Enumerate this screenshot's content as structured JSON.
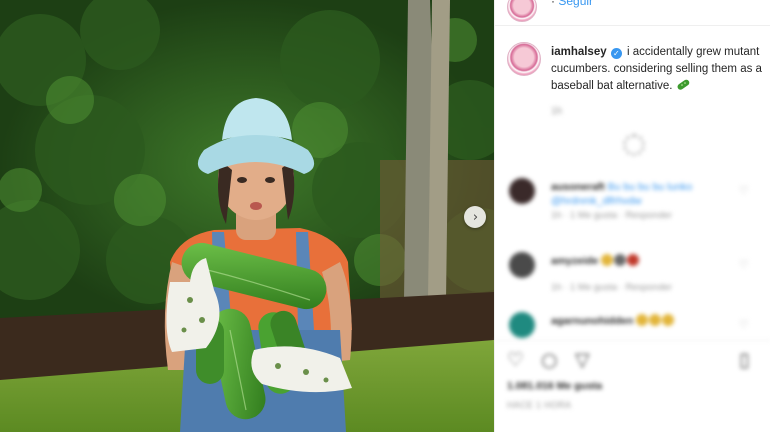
{
  "header_partial": {
    "text": "· ",
    "link": "Seguir"
  },
  "caption": {
    "username": "iamhalsey",
    "text": "i accidentally grew mutant cucumbers. considering selling them as a baseball bat alternative."
  },
  "caption_time": "1h",
  "comments": [
    {
      "username": "ausoneraft",
      "text": "Bu bu bu bu lunko",
      "mention": "@hrdnmk_dlfrhvdw",
      "meta": "1h · 1 Me gusta · Responder"
    },
    {
      "username": "amyzeide",
      "text": "",
      "mention": "",
      "meta": "1h · 1 Me gusta · Responder"
    },
    {
      "username": "agarnunohidden",
      "text": "",
      "mention": "",
      "meta": ""
    }
  ],
  "likes": "1.081.016 Me gusta",
  "post_time": "HACE 1 HORA",
  "icons": {
    "next": "chevron-right-icon",
    "verified": "verified-badge-icon",
    "like": "heart-icon",
    "comment": "comment-bubble-icon",
    "share": "paper-plane-icon",
    "save": "bookmark-icon"
  },
  "colors": {
    "link": "#3897f0",
    "text": "#262626",
    "muted": "#999999"
  }
}
